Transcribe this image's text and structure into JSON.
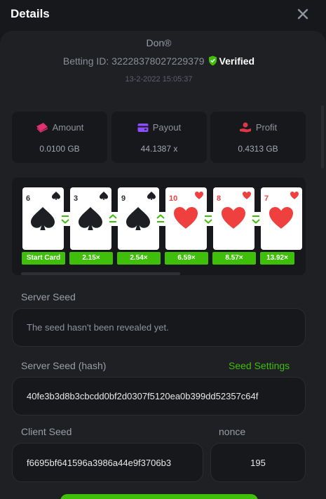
{
  "header": {
    "title": "Details"
  },
  "bet": {
    "user": "Don®",
    "betting_id_label": "Betting ID: 32228378027229379",
    "verified_label": "Verified",
    "date": "13-2-2022 15:05:37"
  },
  "stats": [
    {
      "label": "Amount",
      "value": "0.0100 GB",
      "icon": "money-stack-icon",
      "icon_color": "#e0326e"
    },
    {
      "label": "Payout",
      "value": "44.1387 x",
      "icon": "wallet-icon",
      "icon_color": "#8b4dff"
    },
    {
      "label": "Profit",
      "value": "0.4313 GB",
      "icon": "hand-coin-icon",
      "icon_color": "#e0364a"
    }
  ],
  "cards": [
    {
      "rank": "6",
      "suit": "spade"
    },
    {
      "rank": "3",
      "suit": "spade"
    },
    {
      "rank": "9",
      "suit": "spade"
    },
    {
      "rank": "10",
      "suit": "heart"
    },
    {
      "rank": "8",
      "suit": "heart"
    },
    {
      "rank": "7",
      "suit": "heart"
    }
  ],
  "guesses": [
    "lower",
    "higher",
    "higher",
    "lower",
    "lower"
  ],
  "multipliers": [
    "Start Card",
    "2.15×",
    "2.54×",
    "6.59×",
    "8.57×",
    "13.92×"
  ],
  "server_seed": {
    "label": "Server Seed",
    "value": "The seed hasn't been revealed yet."
  },
  "server_seed_hash": {
    "label": "Server Seed (hash)",
    "link": "Seed Settings",
    "value": "40fe3b3d8b3cbcdd0bf2d0307f5120ea0b399dd52357c64f"
  },
  "client_seed": {
    "label": "Client Seed",
    "value": "f6695bf641596a3986a44e9f3706b3"
  },
  "nonce": {
    "label": "nonce",
    "value": "195"
  },
  "colors": {
    "accent": "#3fbf0a",
    "heart": "#ef3f3f",
    "spade": "#1d1f24"
  }
}
